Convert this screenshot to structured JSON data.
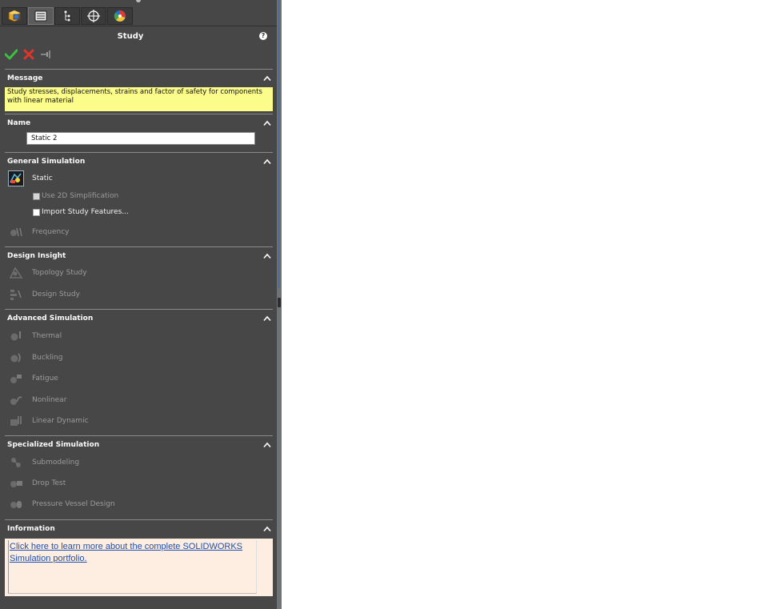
{
  "property_manager": {
    "title": "Study",
    "help_glyph": "?",
    "tabs": [
      {
        "icon": "feature-manager-icon"
      },
      {
        "icon": "property-manager-icon"
      },
      {
        "icon": "configuration-manager-icon"
      },
      {
        "icon": "dimxpert-manager-icon"
      },
      {
        "icon": "display-manager-icon"
      }
    ],
    "actions": {
      "ok": "ok-icon",
      "cancel": "cancel-icon",
      "pin": "pushpin-icon"
    }
  },
  "message": {
    "title": "Message",
    "text": "Study stresses, displacements, strains and factor of safety  for components with linear material"
  },
  "name": {
    "title": "Name",
    "value": "Static 2"
  },
  "general_simulation": {
    "title": "General Simulation",
    "static_label": "Static",
    "use_2d_label": "Use 2D Simplification",
    "import_label": "Import Study Features...",
    "frequency_label": "Frequency"
  },
  "design_insight": {
    "title": "Design Insight",
    "items": [
      "Topology Study",
      "Design Study"
    ]
  },
  "advanced_simulation": {
    "title": "Advanced Simulation",
    "items": [
      "Thermal",
      "Buckling",
      "Fatigue",
      "Nonlinear",
      "Linear Dynamic"
    ]
  },
  "specialized_simulation": {
    "title": "Specialized Simulation",
    "items": [
      "Submodeling",
      "Drop Test",
      "Pressure Vessel Design"
    ]
  },
  "information": {
    "title": "Information",
    "link_line1": "Click here to learn more about the complete SOLIDWORKS",
    "link_line2": "Simulation portfolio."
  },
  "colors": {
    "panel_bg": "#474747",
    "message_bg": "#fcfc8a",
    "info_bg": "#fdeee1",
    "link": "#1f4fb0"
  }
}
